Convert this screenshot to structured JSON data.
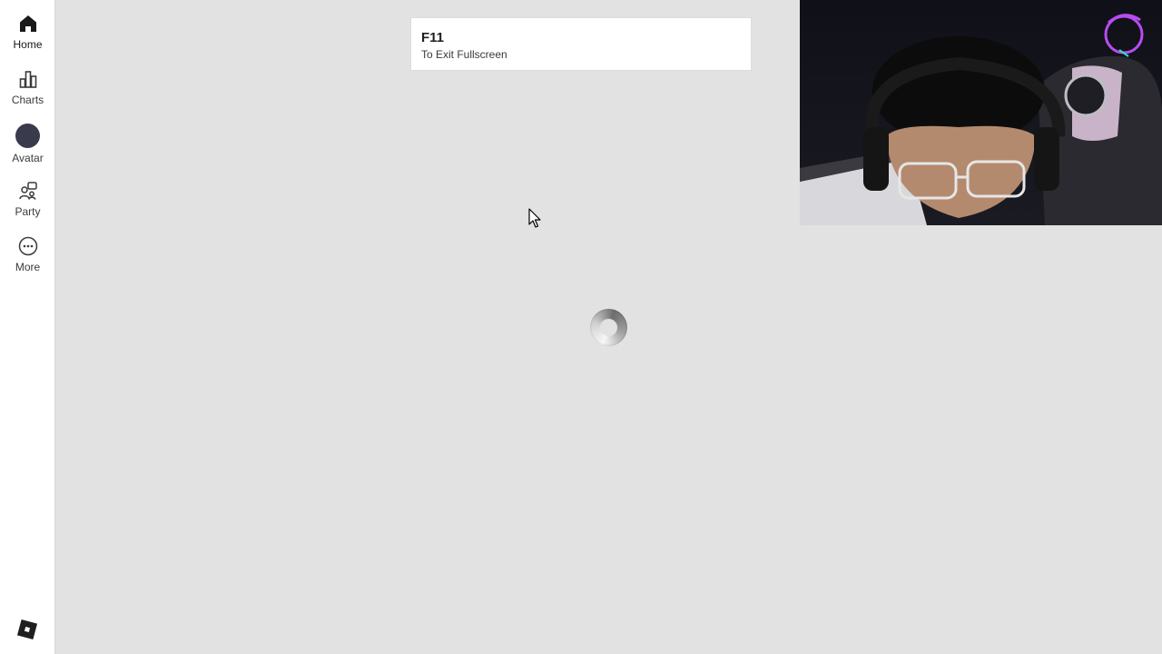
{
  "sidebar": {
    "items": [
      {
        "label": "Home",
        "icon": "home-icon"
      },
      {
        "label": "Charts",
        "icon": "chart-icon"
      },
      {
        "label": "Avatar",
        "icon": "avatar-icon"
      },
      {
        "label": "Party",
        "icon": "party-icon"
      },
      {
        "label": "More",
        "icon": "more-icon"
      }
    ],
    "logo_icon": "roblox-logo-icon"
  },
  "toast": {
    "key": "F11",
    "hint": "To Exit Fullscreen"
  },
  "loading": {
    "icon": "loading-spinner-icon"
  },
  "colors": {
    "background": "#e2e2e2",
    "sidebar": "#ffffff",
    "avatar_dot": "#393b4d"
  }
}
